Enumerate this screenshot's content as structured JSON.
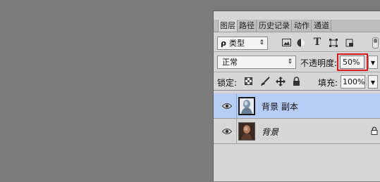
{
  "panel": {
    "tabs": [
      "图层",
      "路径",
      "历史记录",
      "动作",
      "通道"
    ],
    "active_tab": 0
  },
  "filter": {
    "search_glyph": "ρ",
    "kind_label": "类型"
  },
  "blend": {
    "mode": "正常",
    "opacity_label": "不透明度:",
    "opacity_value": "50%"
  },
  "lock": {
    "label": "锁定:",
    "fill_label": "填充:",
    "fill_value": "100%"
  },
  "layers": [
    {
      "name": "背景 副本",
      "selected": true,
      "visible": true
    },
    {
      "name": "背景",
      "selected": false,
      "visible": true,
      "locked": true
    }
  ],
  "colors": {
    "selection": "#b8cdf5",
    "highlight_border": "#d81a1a",
    "canvas": "#7b7b7b"
  }
}
